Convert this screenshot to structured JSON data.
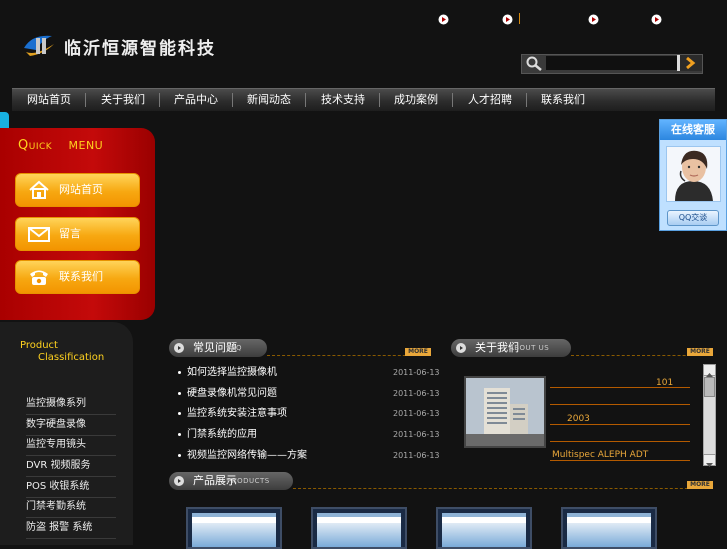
{
  "header": {
    "site_title": "临沂恒源智能科技",
    "search": {
      "placeholder": ""
    }
  },
  "nav": {
    "items": [
      "网站首页",
      "关于我们",
      "产品中心",
      "新闻动态",
      "技术支持",
      "成功案例",
      "人才招聘",
      "联系我们"
    ]
  },
  "quick_menu": {
    "title_prefix": "Q",
    "title_rest": "UICK",
    "title_menu": "MENU",
    "buttons": [
      {
        "label": "网站首页",
        "icon": "home-icon"
      },
      {
        "label": "留言",
        "icon": "mail-icon"
      },
      {
        "label": "联系我们",
        "icon": "phone-icon"
      }
    ]
  },
  "product_classification": {
    "title_line1": "Product",
    "title_line2": "Classification",
    "items": [
      "监控摄像系列",
      "数字硬盘录像",
      "监控专用镜头",
      "DVR 视频服务",
      "POS 收银系统",
      "门禁考勤系统",
      "防盗 报警 系统"
    ]
  },
  "faq": {
    "title_cn": "常见问题",
    "title_en": "FAQ",
    "more": "MORE",
    "items": [
      {
        "text": "如何选择监控摄像机",
        "date": "2011-06-13"
      },
      {
        "text": "硬盘录像机常见问题",
        "date": "2011-06-13"
      },
      {
        "text": "监控系统安装注意事项",
        "date": "2011-06-13"
      },
      {
        "text": "门禁系统的应用",
        "date": "2011-06-13"
      },
      {
        "text": "视频监控网络传输——方案",
        "date": "2011-06-13"
      }
    ]
  },
  "about": {
    "title_cn": "关于我们",
    "title_en": "ABOUT US",
    "more": "MORE",
    "lines": [
      "101",
      "2003",
      "Multispec ALEPH ADT"
    ]
  },
  "products": {
    "title_cn": "产品展示",
    "title_en": "PRODUCTS",
    "more": "MORE"
  },
  "online_service": {
    "title": "在线客服",
    "qq_label": "QQ交谈"
  }
}
